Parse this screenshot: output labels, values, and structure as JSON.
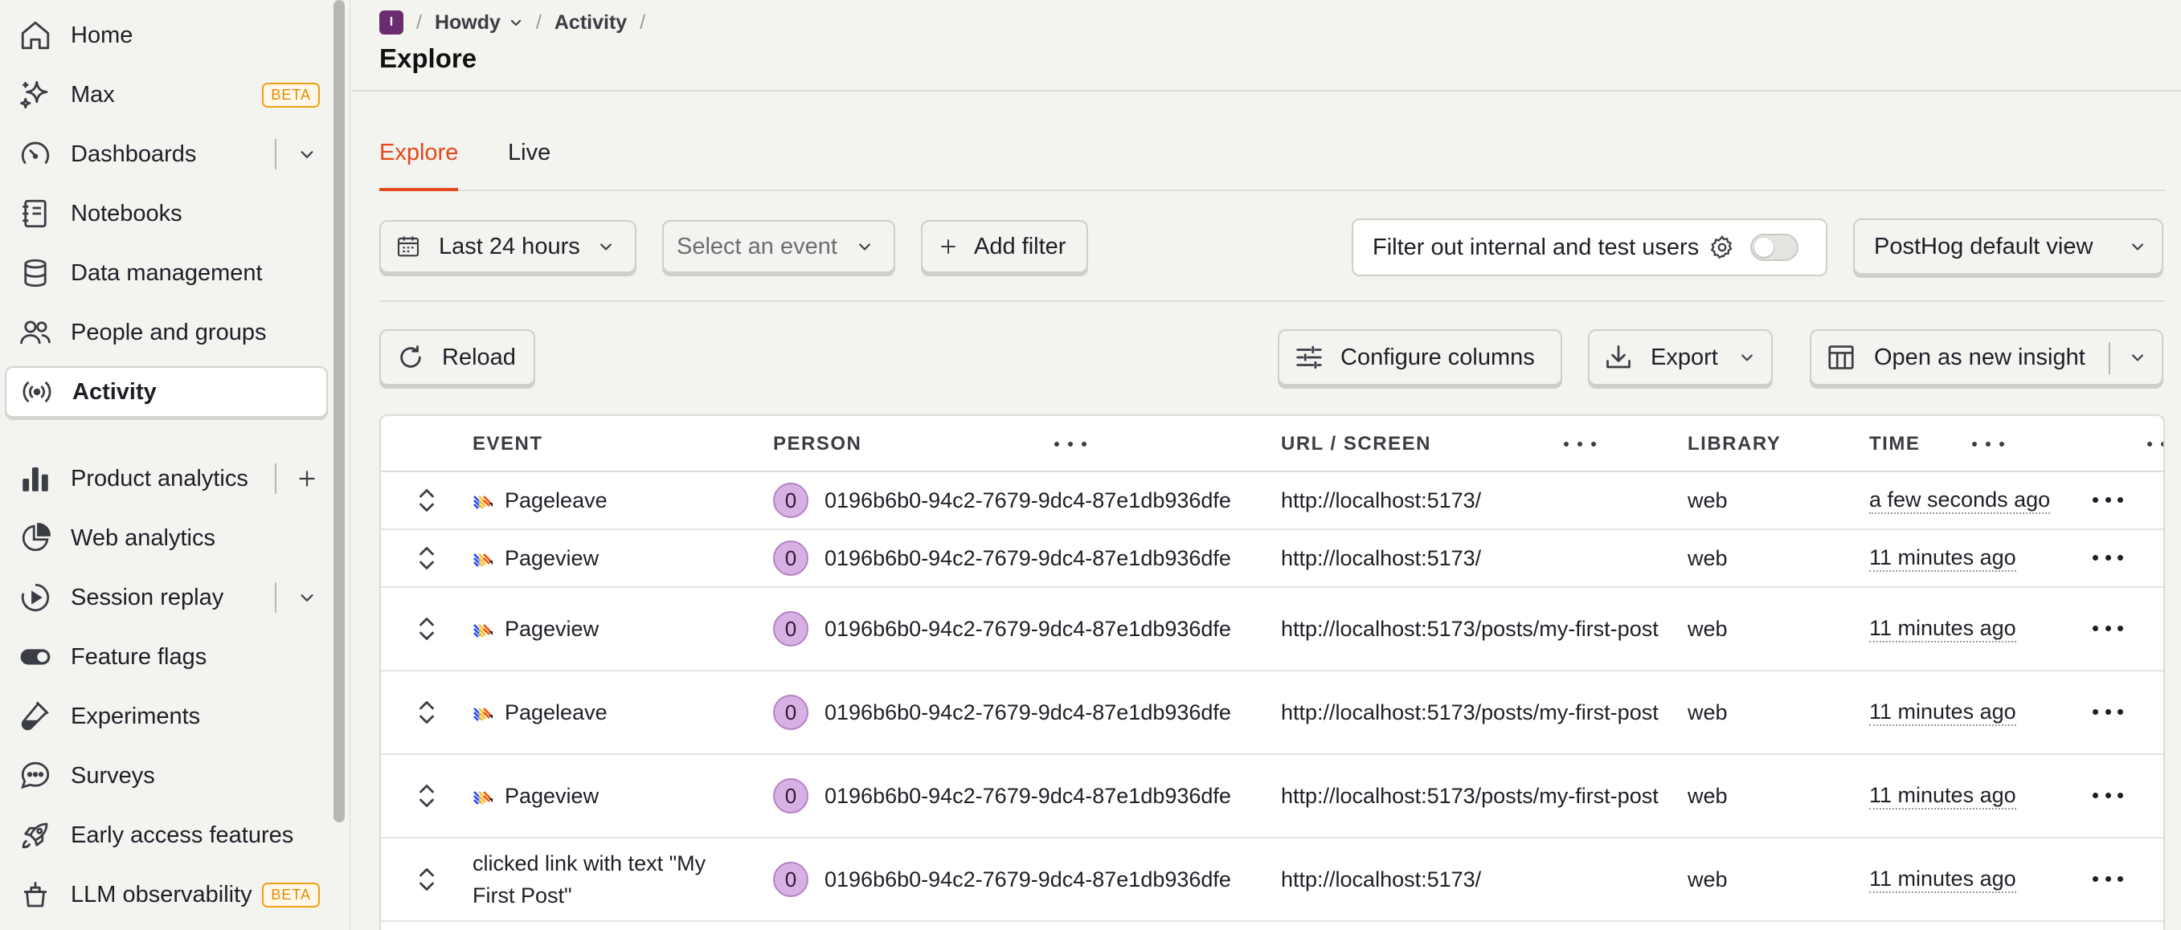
{
  "sidebar": {
    "items": [
      {
        "label": "Home",
        "icon": "home-icon"
      },
      {
        "label": "Max",
        "icon": "sparkle-icon",
        "badge": "BETA"
      },
      {
        "label": "Dashboards",
        "icon": "dashboard-icon"
      },
      {
        "label": "Notebooks",
        "icon": "notebook-icon"
      },
      {
        "label": "Data management",
        "icon": "database-icon"
      },
      {
        "label": "People and groups",
        "icon": "people-icon"
      },
      {
        "label": "Activity",
        "icon": "broadcast-icon",
        "active": true
      },
      {
        "label": "Product analytics",
        "icon": "bar-chart-icon"
      },
      {
        "label": "Web analytics",
        "icon": "pie-chart-icon"
      },
      {
        "label": "Session replay",
        "icon": "play-circle-icon"
      },
      {
        "label": "Feature flags",
        "icon": "toggle-icon"
      },
      {
        "label": "Experiments",
        "icon": "flask-icon"
      },
      {
        "label": "Surveys",
        "icon": "chat-bubble-icon"
      },
      {
        "label": "Early access features",
        "icon": "rocket-icon"
      },
      {
        "label": "LLM observability",
        "icon": "llm-icon",
        "badge": "BETA"
      }
    ]
  },
  "breadcrumb": {
    "project_initial": "I",
    "project": "Howdy",
    "section": "Activity",
    "separator": "/"
  },
  "page": {
    "title": "Explore"
  },
  "tabs": [
    {
      "label": "Explore",
      "active": true
    },
    {
      "label": "Live",
      "active": false
    }
  ],
  "filters": {
    "date_range": "Last 24 hours",
    "event_placeholder": "Select an event",
    "add_filter": "Add filter",
    "internal_users": "Filter out internal and test users",
    "view": "PostHog default view"
  },
  "toolbar": {
    "reload": "Reload",
    "configure_columns": "Configure columns",
    "export": "Export",
    "open_insight": "Open as new insight"
  },
  "table": {
    "columns": [
      "EVENT",
      "PERSON",
      "URL / SCREEN",
      "LIBRARY",
      "TIME"
    ],
    "rows": [
      {
        "event": "Pageleave",
        "has_icon": true,
        "person_initial": "0",
        "person": "0196b6b0-94c2-7679-9dc4-87e1db936dfe",
        "url": "http://localhost:5173/",
        "library": "web",
        "time": "a few seconds ago"
      },
      {
        "event": "Pageview",
        "has_icon": true,
        "person_initial": "0",
        "person": "0196b6b0-94c2-7679-9dc4-87e1db936dfe",
        "url": "http://localhost:5173/",
        "library": "web",
        "time": "11 minutes ago"
      },
      {
        "event": "Pageview",
        "has_icon": true,
        "person_initial": "0",
        "person": "0196b6b0-94c2-7679-9dc4-87e1db936dfe",
        "url": "http://localhost:5173/posts/my-first-post",
        "library": "web",
        "time": "11 minutes ago"
      },
      {
        "event": "Pageleave",
        "has_icon": true,
        "person_initial": "0",
        "person": "0196b6b0-94c2-7679-9dc4-87e1db936dfe",
        "url": "http://localhost:5173/posts/my-first-post",
        "library": "web",
        "time": "11 minutes ago"
      },
      {
        "event": "Pageview",
        "has_icon": true,
        "person_initial": "0",
        "person": "0196b6b0-94c2-7679-9dc4-87e1db936dfe",
        "url": "http://localhost:5173/posts/my-first-post",
        "library": "web",
        "time": "11 minutes ago"
      },
      {
        "event": "clicked link with text \"My First Post\"",
        "has_icon": false,
        "person_initial": "0",
        "person": "0196b6b0-94c2-7679-9dc4-87e1db936dfe",
        "url": "http://localhost:5173/",
        "library": "web",
        "time": "11 minutes ago"
      }
    ]
  },
  "colors": {
    "accent": "#e5481a",
    "beta_badge": "#f0a012",
    "person_avatar": "#d8b1e4",
    "project_avatar": "#6b2c6e"
  }
}
